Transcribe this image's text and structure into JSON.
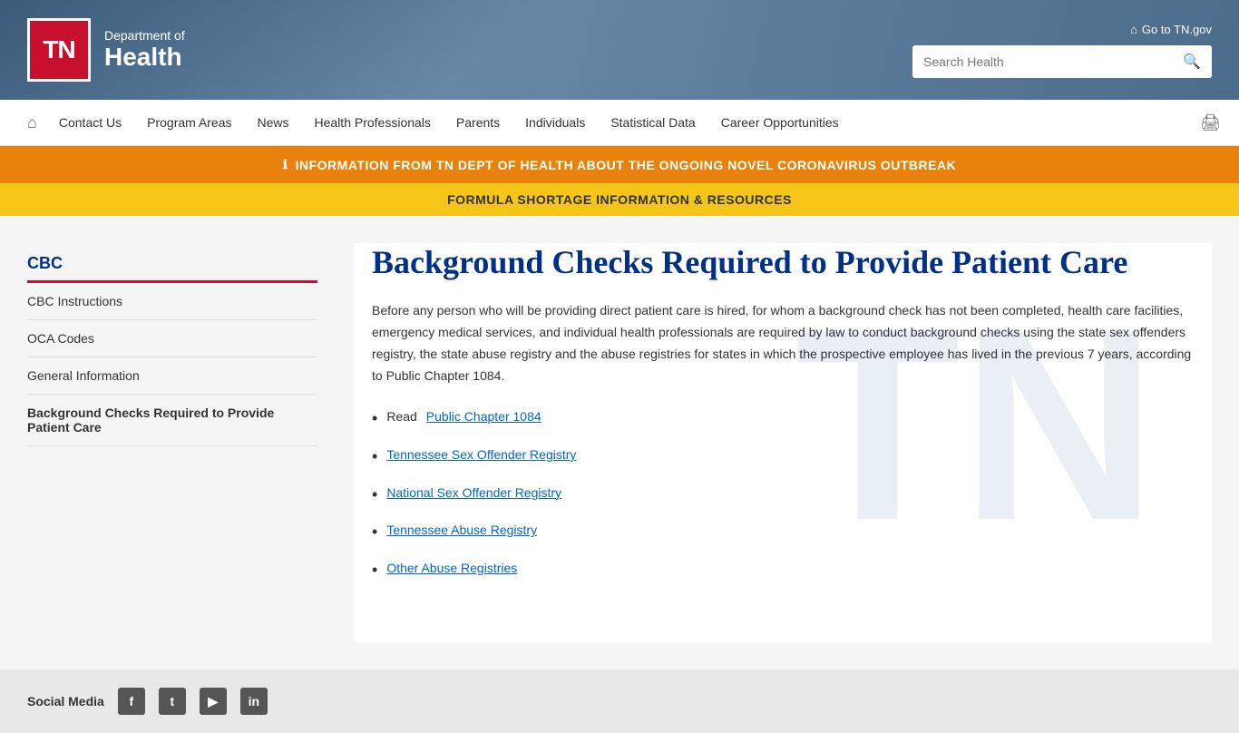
{
  "header": {
    "logo_text": "TN",
    "dept_of": "Department of",
    "health": "Health",
    "go_to_tn": "Go to TN.gov",
    "search_placeholder": "Search Health"
  },
  "navbar": {
    "home_icon": "⌂",
    "print_icon": "🖨",
    "items": [
      {
        "label": "Contact Us"
      },
      {
        "label": "Program Areas"
      },
      {
        "label": "News"
      },
      {
        "label": "Health Professionals"
      },
      {
        "label": "Parents"
      },
      {
        "label": "Individuals"
      },
      {
        "label": "Statistical Data"
      },
      {
        "label": "Career Opportunities"
      }
    ]
  },
  "banners": {
    "orange_icon": "ℹ",
    "orange_text": "INFORMATION FROM TN DEPT OF HEALTH ABOUT THE ONGOING NOVEL CORONAVIRUS OUTBREAK",
    "yellow_text": "FORMULA SHORTAGE INFORMATION & RESOURCES"
  },
  "sidebar": {
    "items": [
      {
        "label": "CBC",
        "type": "active-top"
      },
      {
        "label": "CBC Instructions",
        "type": "normal"
      },
      {
        "label": "OCA Codes",
        "type": "normal"
      },
      {
        "label": "General Information",
        "type": "normal"
      },
      {
        "label": "Background Checks Required to Provide Patient Care",
        "type": "current"
      }
    ]
  },
  "content": {
    "title": "Background Checks Required to Provide Patient Care",
    "body": "Before any person who will be providing direct patient care is hired, for whom a background check has not been completed, health care facilities, emergency medical services, and individual health professionals are required by law to conduct background checks using the state sex offenders registry, the state abuse registry and the abuse registries for states in which the prospective employee has lived in the previous 7 years, according to Public Chapter 1084.",
    "links": [
      {
        "prefix": "Read ",
        "label": "Public Chapter 1084",
        "href": "#"
      },
      {
        "prefix": "",
        "label": "Tennessee Sex Offender Registry",
        "href": "#"
      },
      {
        "prefix": "",
        "label": "National Sex Offender Registry",
        "href": "#"
      },
      {
        "prefix": "",
        "label": "Tennessee Abuse Registry",
        "href": "#"
      },
      {
        "prefix": "",
        "label": "Other Abuse Registries",
        "href": "#"
      }
    ]
  },
  "footer": {
    "social_media_label": "Social Media",
    "social_icons": [
      "f",
      "t",
      "▶",
      "in"
    ]
  }
}
